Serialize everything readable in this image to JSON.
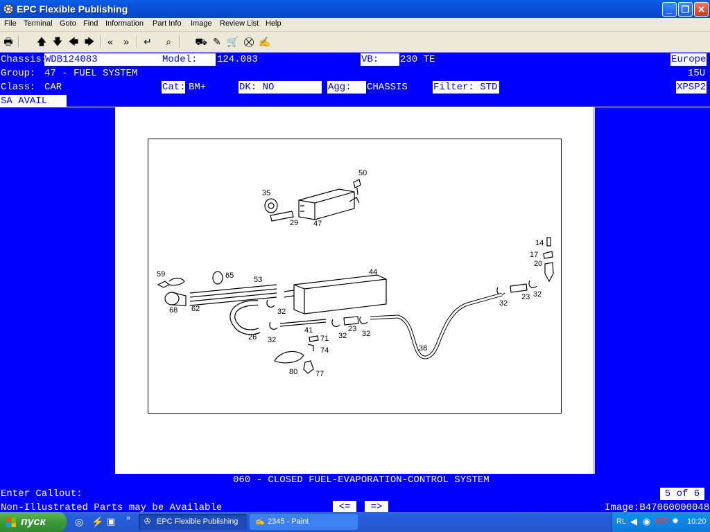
{
  "window": {
    "title": "EPC Flexible Publishing"
  },
  "menu": [
    "File",
    "Terminal",
    "Goto",
    "Find",
    "Information",
    "Part Info",
    "Image",
    "Review List",
    "Help"
  ],
  "header": {
    "chassis_label": "Chassis:",
    "chassis_value": "WDB124083",
    "model_label": "Model:",
    "model_value": "124.083",
    "vb_label": "VB:",
    "vb_value": "230 TE",
    "region": "Europe",
    "group_label": "Group:",
    "group_value": "47 - FUEL SYSTEM",
    "group_code": "15U",
    "class_label": "Class:",
    "class_value": "CAR",
    "cat_label": "Cat:",
    "cat_value": "BM+",
    "dk_label": "DK:",
    "dk_value": "NO",
    "agg_label": "Agg:",
    "agg_value": "CHASSIS",
    "filter_label": "Filter:",
    "filter_value": "STD",
    "code": "XPSP2",
    "sa_avail": "SA AVAIL"
  },
  "diagram": {
    "caption": "060 - CLOSED FUEL-EVAPORATION-CONTROL SYSTEM",
    "callouts": [
      "50",
      "35",
      "29",
      "47",
      "14",
      "17",
      "20",
      "59",
      "65",
      "53",
      "44",
      "68",
      "62",
      "32",
      "26",
      "41",
      "23",
      "71",
      "74",
      "80",
      "77",
      "38"
    ]
  },
  "footer": {
    "prompt": "Enter Callout:",
    "page": "5 of 6",
    "note": "Non-Illustrated Parts may be Available",
    "prev_label": "<=",
    "next_label": "=>",
    "image_id": "Image:B47060000048"
  },
  "taskbar": {
    "start": "пуск",
    "tasks": [
      "EPC Flexible Publishing",
      "2345 - Paint"
    ],
    "lang": "RL",
    "clock": "10:20"
  },
  "colors": {
    "terminal_bg": "#0000FF",
    "xp_blue": "#245EDC"
  }
}
